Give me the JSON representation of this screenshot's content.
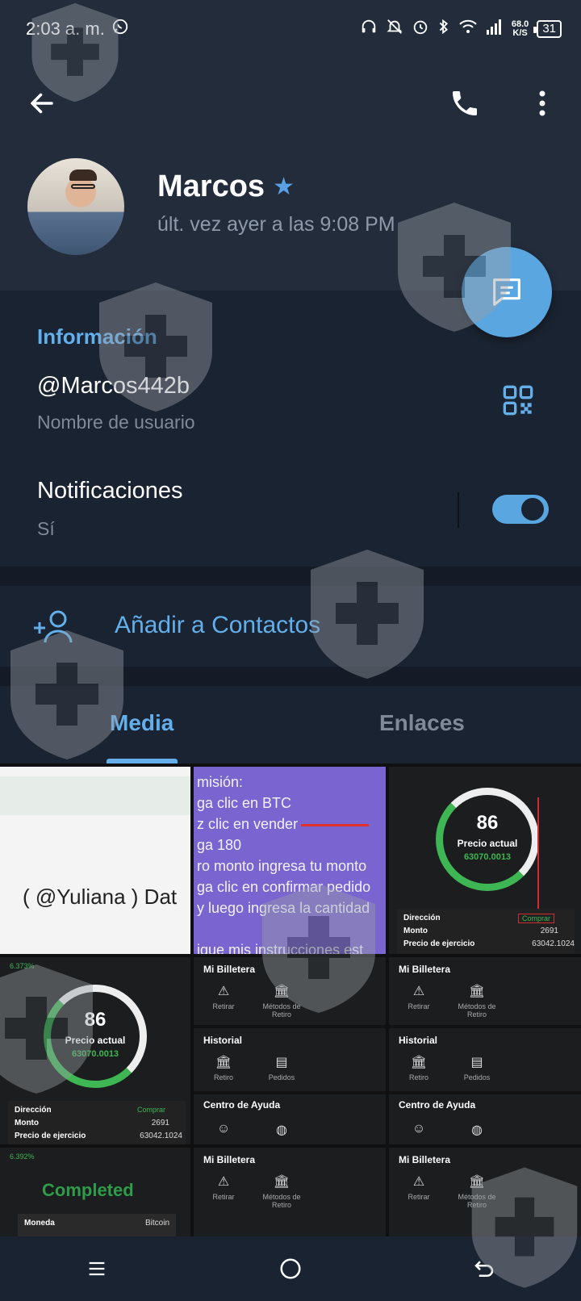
{
  "status_bar": {
    "time": "2:03 a. m.",
    "net_speed_value": "68.0",
    "net_speed_unit": "K/S",
    "battery": "31"
  },
  "header": {
    "contact_name": "Marcos",
    "last_seen": "últ. vez ayer a las 9:08 PM"
  },
  "info": {
    "section_title": "Información",
    "username": "@Marcos442b",
    "username_label": "Nombre de usuario",
    "notifications_title": "Notificaciones",
    "notifications_value": "Sí",
    "notifications_enabled": true
  },
  "add_contact": {
    "label": "Añadir a Contactos"
  },
  "tabs": [
    {
      "label": "Media",
      "active": true
    },
    {
      "label": "Enlaces",
      "active": false
    }
  ],
  "media": {
    "thumb1": {
      "text": "( @Yuliana ) Dat"
    },
    "thumb2": {
      "lines": [
        "misión:",
        "ga clic en BTC",
        "z clic en vender",
        "ga 180",
        "ro monto ingresa tu monto",
        "ga clic en confirmar pedido",
        "y luego ingresa la cantidad",
        "",
        "igue mis instrucciones est"
      ]
    },
    "thumb3": {
      "gauge_value": "86",
      "gauge_label": "Precio actual",
      "price": "63070.0013",
      "rows": [
        {
          "key": "Dirección",
          "value": "Comprar"
        },
        {
          "key": "Monto",
          "value": "2691"
        },
        {
          "key": "Precio de ejercicio",
          "value": "63042.1024"
        }
      ]
    },
    "thumb4": {
      "top_value": "6.373%",
      "gauge_value": "86",
      "gauge_label": "Precio actual",
      "price": "63070.0013",
      "rows": [
        {
          "key": "Dirección",
          "value": "Comprar"
        },
        {
          "key": "Monto",
          "value": "2691"
        },
        {
          "key": "Precio de ejercicio",
          "value": "63042.1024"
        }
      ]
    },
    "wallet": {
      "title": "Mi Billetera",
      "retirar": "Retirar",
      "metodos": "Métodos de Retiro",
      "historial": "Historial",
      "retiro": "Retiro",
      "pedidos": "Pedidos",
      "ayuda": "Centro de Ayuda"
    },
    "thumb7": {
      "top_value": "6.392%",
      "status": "Completed",
      "row_key": "Moneda",
      "row_value": "Bitcoin"
    }
  },
  "colors": {
    "accent": "#64aeea",
    "header_bg": "#222c3b",
    "body_bg": "#1a2331",
    "fab": "#5aa6e0"
  },
  "icons": {
    "back": "arrow-left-icon",
    "call": "phone-icon",
    "more": "dots-vertical-icon",
    "fab": "message-icon",
    "qr": "qr-code-icon",
    "add_contact": "add-user-icon",
    "star": "star-icon"
  }
}
